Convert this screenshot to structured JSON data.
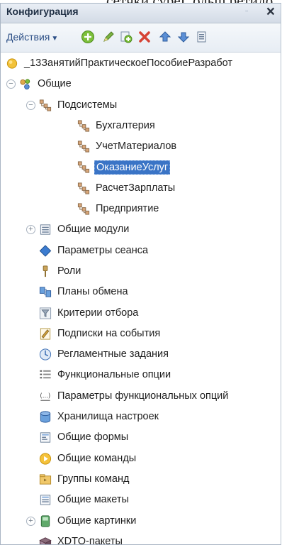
{
  "cropped_text": "сетчки суреГ ольщ ретидо",
  "panel": {
    "title": "Конфигурация",
    "close_glyph": "×",
    "pin_glyph": "▫"
  },
  "toolbar": {
    "actions_label": "Действия",
    "buttons": [
      "add-icon",
      "edit-icon",
      "copy-icon",
      "delete-icon",
      "move-up-icon",
      "move-down-icon",
      "list-icon"
    ]
  },
  "tree": {
    "items": [
      {
        "label": "_13ЗанятийПрактическоеПособиеРазработ",
        "icon": "config-root-icon",
        "level": 0,
        "expander": ""
      },
      {
        "label": "Общие",
        "icon": "common-icon",
        "level": 1,
        "expander": "−"
      },
      {
        "label": "Подсистемы",
        "icon": "subsystems-icon",
        "level": 2,
        "expander": "−"
      },
      {
        "label": "Бухгалтерия",
        "icon": "subsystem-icon",
        "level": 3,
        "expander": ""
      },
      {
        "label": "УчетМатериалов",
        "icon": "subsystem-icon",
        "level": 3,
        "expander": ""
      },
      {
        "label": "ОказаниеУслуг",
        "icon": "subsystem-icon",
        "level": 3,
        "expander": "",
        "selected": true
      },
      {
        "label": "РасчетЗарплаты",
        "icon": "subsystem-icon",
        "level": 3,
        "expander": ""
      },
      {
        "label": "Предприятие",
        "icon": "subsystem-icon",
        "level": 3,
        "expander": ""
      },
      {
        "label": "Общие модули",
        "icon": "common-modules-icon",
        "level": 2,
        "expander": "+"
      },
      {
        "label": "Параметры сеанса",
        "icon": "session-params-icon",
        "level": 2,
        "expander": ""
      },
      {
        "label": "Роли",
        "icon": "roles-icon",
        "level": 2,
        "expander": ""
      },
      {
        "label": "Планы обмена",
        "icon": "exchange-plans-icon",
        "level": 2,
        "expander": ""
      },
      {
        "label": "Критерии отбора",
        "icon": "filter-criteria-icon",
        "level": 2,
        "expander": ""
      },
      {
        "label": "Подписки на события",
        "icon": "event-subscriptions-icon",
        "level": 2,
        "expander": ""
      },
      {
        "label": "Регламентные задания",
        "icon": "scheduled-jobs-icon",
        "level": 2,
        "expander": ""
      },
      {
        "label": "Функциональные опции",
        "icon": "functional-options-icon",
        "level": 2,
        "expander": ""
      },
      {
        "label": "Параметры функциональных опций",
        "icon": "functional-option-params-icon",
        "level": 2,
        "expander": ""
      },
      {
        "label": "Хранилища настроек",
        "icon": "settings-storages-icon",
        "level": 2,
        "expander": ""
      },
      {
        "label": "Общие формы",
        "icon": "common-forms-icon",
        "level": 2,
        "expander": ""
      },
      {
        "label": "Общие команды",
        "icon": "common-commands-icon",
        "level": 2,
        "expander": ""
      },
      {
        "label": "Группы команд",
        "icon": "command-groups-icon",
        "level": 2,
        "expander": ""
      },
      {
        "label": "Общие макеты",
        "icon": "common-templates-icon",
        "level": 2,
        "expander": ""
      },
      {
        "label": "Общие картинки",
        "icon": "common-pictures-icon",
        "level": 2,
        "expander": "+"
      },
      {
        "label": "XDTO-пакеты",
        "icon": "xdto-packages-icon",
        "level": 2,
        "expander": ""
      }
    ]
  }
}
